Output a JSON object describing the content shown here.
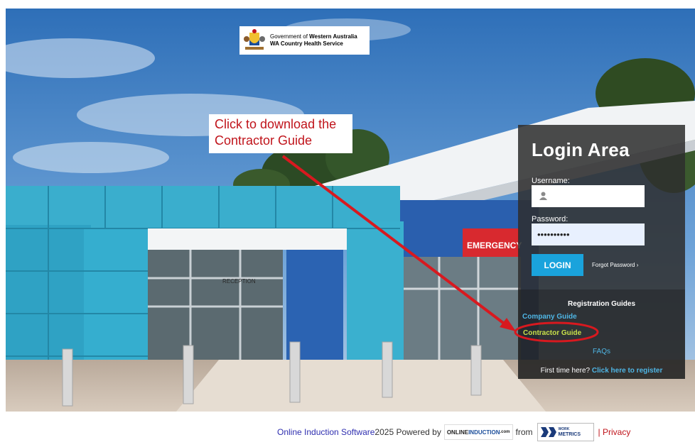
{
  "header": {
    "gov_line1_prefix": "Government of ",
    "gov_line1_bold": "Western Australia",
    "gov_line2": "WA Country Health Service"
  },
  "annotation": {
    "line1": "Click to download the",
    "line2": "Contractor Guide",
    "color": "#c0141b"
  },
  "scene": {
    "emergency_sign": "EMERGENCY",
    "reception_sign": "RECEPTION"
  },
  "login": {
    "title": "Login Area",
    "username_label": "Username:",
    "password_label": "Password:",
    "password_value": "••••••••••",
    "login_button": "LOGIN",
    "forgot_password": "Forgot Password ›"
  },
  "registration": {
    "title": "Registration Guides",
    "company_guide": "Company Guide",
    "contractor_guide": "Contractor Guide",
    "faqs": "FAQs",
    "first_time": "First time here? ",
    "register_link": "Click here to register"
  },
  "footer": {
    "software_link": "Online Induction Software",
    "powered": " 2025 Powered by",
    "online_logo_a": "ONLINE",
    "online_logo_b": "INDUCTION",
    "online_logo_c": ".com",
    "from": "from",
    "wm_top": "WORK",
    "wm_bottom": "METRICS",
    "privacy": "| Privacy"
  },
  "colors": {
    "accent_blue": "#1aa3dc",
    "link_blue": "#4fb6e5",
    "contractor_green": "#c8e04a",
    "annotation_red": "#c0141b"
  }
}
